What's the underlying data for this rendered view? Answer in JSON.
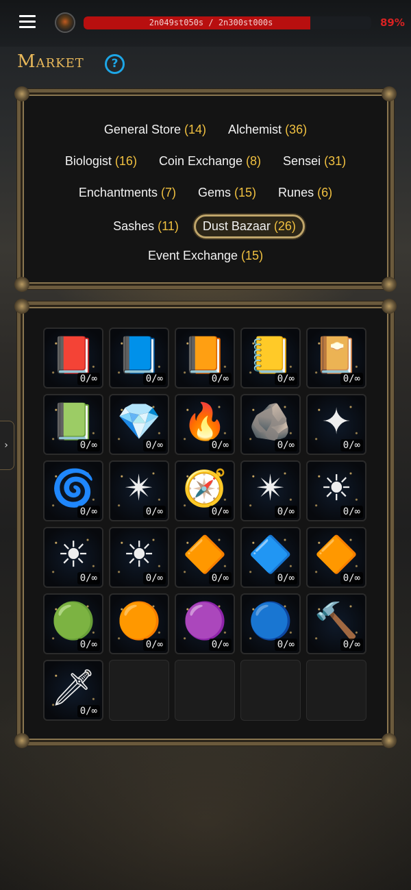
{
  "header": {
    "xp_text": "2n049st050s / 2n300st000s",
    "xp_fraction": 0.89,
    "xp_percent": "89%"
  },
  "title": "Market",
  "help_label": "?",
  "shops": [
    [
      {
        "name": "General Store",
        "count": "(14)"
      },
      {
        "name": "Alchemist",
        "count": "(36)"
      }
    ],
    [
      {
        "name": "Biologist",
        "count": "(16)"
      },
      {
        "name": "Coin Exchange",
        "count": "(8)"
      },
      {
        "name": "Sensei",
        "count": "(31)"
      }
    ],
    [
      {
        "name": "Enchantments",
        "count": "(7)"
      },
      {
        "name": "Gems",
        "count": "(15)"
      },
      {
        "name": "Runes",
        "count": "(6)"
      }
    ],
    [
      {
        "name": "Sashes",
        "count": "(11)"
      },
      {
        "name": "Dust Bazaar",
        "count": "(26)",
        "active": true
      }
    ],
    [
      {
        "name": "Event Exchange",
        "count": "(15)"
      }
    ]
  ],
  "items": [
    {
      "icon": "purple-gem-tome-icon",
      "glyph": "📕",
      "hue": 0,
      "qty": "0/∞"
    },
    {
      "icon": "blue-crystal-tome-icon",
      "glyph": "📘",
      "hue": 0,
      "qty": "0/∞"
    },
    {
      "icon": "red-heart-tome-icon",
      "glyph": "📙",
      "hue": 0,
      "qty": "0/∞"
    },
    {
      "icon": "golden-orb-tome-icon",
      "glyph": "📒",
      "hue": 0,
      "qty": "0/∞"
    },
    {
      "icon": "purple-rune-tome-icon",
      "glyph": "📔",
      "hue": 0,
      "qty": "0/∞"
    },
    {
      "icon": "green-tree-tome-icon",
      "glyph": "📗",
      "hue": 0,
      "qty": "0/∞"
    },
    {
      "icon": "ice-crystal-icon",
      "glyph": "💎",
      "hue": 0,
      "qty": "0/∞"
    },
    {
      "icon": "fire-crystal-icon",
      "glyph": "🔥",
      "hue": 0,
      "qty": "0/∞"
    },
    {
      "icon": "earth-crystal-icon",
      "glyph": "🪨",
      "hue": 0,
      "qty": "0/∞"
    },
    {
      "icon": "golden-star-icon",
      "glyph": "✦",
      "hue": 0,
      "qty": "0/∞"
    },
    {
      "icon": "water-swirl-icon",
      "glyph": "🌀",
      "hue": 0,
      "qty": "0/∞"
    },
    {
      "icon": "white-star-emblem-icon",
      "glyph": "✴",
      "hue": 0,
      "qty": "0/∞"
    },
    {
      "icon": "blue-orb-compass-icon",
      "glyph": "🧭",
      "hue": 0,
      "qty": "0/∞"
    },
    {
      "icon": "purple-star-emblem-icon",
      "glyph": "✴",
      "hue": 0,
      "qty": "0/∞"
    },
    {
      "icon": "golden-sun-emblem-icon",
      "glyph": "☀",
      "hue": 0,
      "qty": "0/∞"
    },
    {
      "icon": "fire-sun-emblem-icon",
      "glyph": "☀",
      "hue": 0,
      "qty": "0/∞"
    },
    {
      "icon": "flame-sun-emblem-icon",
      "glyph": "☀",
      "hue": 0,
      "qty": "0/∞"
    },
    {
      "icon": "orange-orb-emblem-icon",
      "glyph": "🔶",
      "hue": 0,
      "qty": "0/∞"
    },
    {
      "icon": "blue-orb-emblem-icon",
      "glyph": "🔷",
      "hue": 0,
      "qty": "0/∞"
    },
    {
      "icon": "amber-orb-emblem-icon",
      "glyph": "🔶",
      "hue": 0,
      "qty": "0/∞"
    },
    {
      "icon": "green-orb-emblem-icon",
      "glyph": "🟢",
      "hue": 0,
      "qty": "0/∞"
    },
    {
      "icon": "bronze-orb-emblem-icon",
      "glyph": "🟠",
      "hue": 0,
      "qty": "0/∞"
    },
    {
      "icon": "violet-orb-emblem-icon",
      "glyph": "🟣",
      "hue": 0,
      "qty": "0/∞"
    },
    {
      "icon": "blue-compass-medallion-icon",
      "glyph": "🔵",
      "hue": 0,
      "qty": "0/∞"
    },
    {
      "icon": "rune-hammer-icon",
      "glyph": "🔨",
      "hue": 0,
      "qty": "0/∞"
    },
    {
      "icon": "crimson-sword-icon",
      "glyph": "🗡",
      "hue": 0,
      "qty": "0/∞"
    },
    {
      "empty": true
    },
    {
      "empty": true
    },
    {
      "empty": true
    },
    {
      "empty": true
    }
  ],
  "colors": {
    "accent_gold": "#f0c040",
    "xp_fill": "#b80f0f",
    "help_blue": "#1da6e6"
  }
}
